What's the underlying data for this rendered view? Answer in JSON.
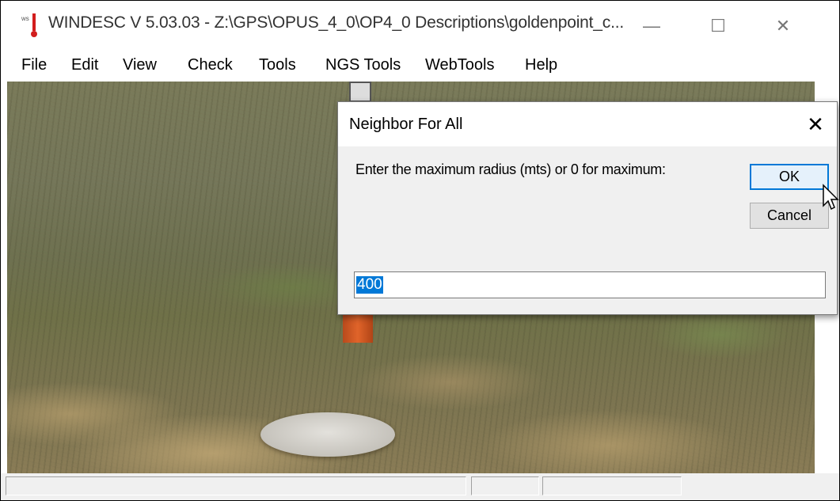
{
  "window": {
    "title": "WINDESC V 5.03.03 - Z:\\GPS\\OPUS_4_0\\OP4_0 Descriptions\\goldenpoint_c...",
    "controls": {
      "minimize": "—",
      "maximize": "☐",
      "close": "✕"
    }
  },
  "menu": {
    "items": [
      "File",
      "Edit",
      "View",
      "Check",
      "Tools",
      "NGS Tools",
      "WebTools",
      "Help"
    ]
  },
  "dialog": {
    "title": "Neighbor For All",
    "close_glyph": "✕",
    "prompt": "Enter the maximum radius (mts) or 0 for maximum:",
    "ok_label": "OK",
    "cancel_label": "Cancel",
    "input_value": "400"
  },
  "statusbar": {
    "panels": [
      "",
      "",
      ""
    ]
  },
  "colors": {
    "accent": "#0078d7",
    "dialog_bg": "#f0f0f0",
    "post": "#e0642a"
  },
  "icons": [
    "app-thermometer-icon",
    "mouse-pointer-icon"
  ]
}
